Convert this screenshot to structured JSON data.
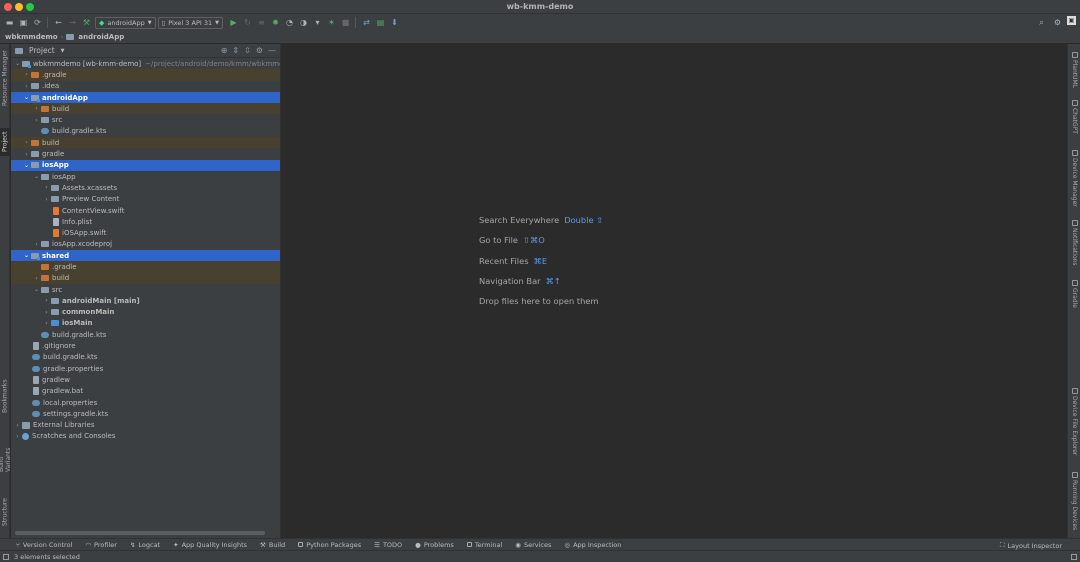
{
  "window": {
    "title": "wb-kmm-demo"
  },
  "toolbar": {
    "run_config": "androidApp",
    "device": "Pixel 3 API 31"
  },
  "breadcrumb": [
    {
      "label": "wbkmmdemo"
    },
    {
      "label": "androidApp"
    }
  ],
  "left_stripe": {
    "tabs": [
      "Resource Manager",
      "Project",
      "Bookmarks",
      "Build Variants",
      "Structure"
    ]
  },
  "right_stripe": {
    "tabs": [
      "PlantUML",
      "ChatGPT",
      "Device Manager",
      "Notifications",
      "Gradle",
      "Device File Explorer",
      "Running Devices"
    ]
  },
  "project_panel": {
    "title": "Project",
    "root": {
      "label": "wbkmmdemo [wb-kmm-demo]",
      "path": "~/project/android/demo/kmm/wbkmmde"
    },
    "items": [
      {
        "label": ".gradle"
      },
      {
        "label": ".idea"
      },
      {
        "label": "androidApp"
      },
      {
        "label": "build"
      },
      {
        "label": "src"
      },
      {
        "label": "build.gradle.kts"
      },
      {
        "label": "build"
      },
      {
        "label": "gradle"
      },
      {
        "label": "iosApp"
      },
      {
        "label": "iosApp"
      },
      {
        "label": "Assets.xcassets"
      },
      {
        "label": "Preview Content"
      },
      {
        "label": "ContentView.swift"
      },
      {
        "label": "Info.plist"
      },
      {
        "label": "iOSApp.swift"
      },
      {
        "label": "iosApp.xcodeproj"
      },
      {
        "label": "shared"
      },
      {
        "label": ".gradle"
      },
      {
        "label": "build"
      },
      {
        "label": "src"
      },
      {
        "label": "androidMain [main]"
      },
      {
        "label": "commonMain"
      },
      {
        "label": "iosMain"
      },
      {
        "label": "build.gradle.kts"
      },
      {
        "label": ".gitignore"
      },
      {
        "label": "build.gradle.kts"
      },
      {
        "label": "gradle.properties"
      },
      {
        "label": "gradlew"
      },
      {
        "label": "gradlew.bat"
      },
      {
        "label": "local.properties"
      },
      {
        "label": "settings.gradle.kts"
      },
      {
        "label": "External Libraries"
      },
      {
        "label": "Scratches and Consoles"
      }
    ]
  },
  "editor": {
    "hints": [
      {
        "label": "Search Everywhere",
        "shortcut": "Double ⇧"
      },
      {
        "label": "Go to File",
        "shortcut": "⇧⌘O"
      },
      {
        "label": "Recent Files",
        "shortcut": "⌘E"
      },
      {
        "label": "Navigation Bar",
        "shortcut": "⌘↑"
      },
      {
        "label": "Drop files here to open them",
        "shortcut": ""
      }
    ]
  },
  "bottom_tools": [
    {
      "label": "Version Control"
    },
    {
      "label": "Profiler"
    },
    {
      "label": "Logcat"
    },
    {
      "label": "App Quality Insights"
    },
    {
      "label": "Build"
    },
    {
      "label": "Python Packages"
    },
    {
      "label": "TODO"
    },
    {
      "label": "Problems"
    },
    {
      "label": "Terminal"
    },
    {
      "label": "Services"
    },
    {
      "label": "App Inspection"
    }
  ],
  "bottom_right_tool": "Layout Inspector",
  "status": {
    "text": "3 elements selected"
  },
  "colors": {
    "selection": "#2f65ca",
    "excluded_bg": "#49412f",
    "shortcut": "#589df6",
    "folder_orange": "#c2733b"
  }
}
